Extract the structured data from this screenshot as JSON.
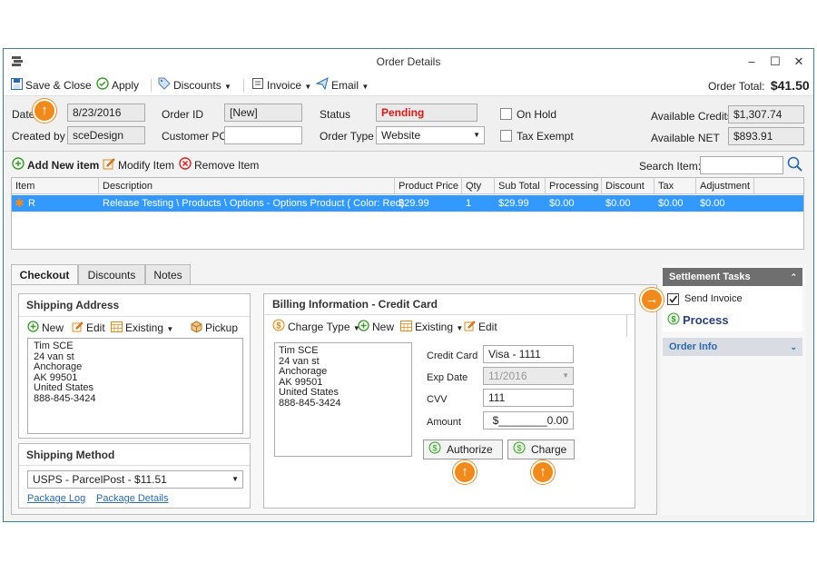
{
  "window": {
    "title": "Order Details"
  },
  "toolbar": {
    "save_close": "Save & Close",
    "apply": "Apply",
    "discounts": "Discounts",
    "invoice": "Invoice",
    "email": "Email",
    "order_total_label": "Order Total:",
    "order_total_value": "$41.50"
  },
  "header": {
    "date_label": "Date",
    "date_value": "8/23/2016",
    "created_by_label": "Created by",
    "created_by_value": "sceDesign",
    "order_id_label": "Order ID",
    "order_id_value": "[New]",
    "customer_po_label": "Customer PO",
    "customer_po_value": "",
    "status_label": "Status",
    "status_value": "Pending",
    "order_type_label": "Order Type",
    "order_type_value": "Website",
    "on_hold_label": "On Hold",
    "tax_exempt_label": "Tax Exempt",
    "available_credits_label": "Available Credits",
    "available_credits_value": "$1,307.74",
    "available_net_label": "Available NET",
    "available_net_value": "$893.91"
  },
  "items_bar": {
    "add": "Add New item",
    "modify": "Modify Item",
    "remove": "Remove Item",
    "search_label": "Search Item:",
    "search_value": ""
  },
  "grid": {
    "columns": [
      "Item",
      "Description",
      "Product Price",
      "Qty",
      "Sub Total",
      "Processing",
      "Discount",
      "Tax",
      "Adjustment"
    ],
    "rows": [
      [
        "R",
        "Release Testing \\ Products \\ Options - Options Product ( Color: Red)",
        "$29.99",
        "1",
        "$29.99",
        "$0.00",
        "$0.00",
        "$0.00",
        "$0.00"
      ]
    ]
  },
  "tabs": {
    "checkout": "Checkout",
    "discounts": "Discounts",
    "notes": "Notes"
  },
  "shipping_address": {
    "title": "Shipping Address",
    "new": "New",
    "edit": "Edit",
    "existing": "Existing",
    "pickup": "Pickup",
    "lines": [
      "Tim SCE",
      "24 van st",
      "Anchorage",
      "AK 99501",
      "United States",
      "888-845-3424"
    ]
  },
  "shipping_method": {
    "title": "Shipping Method",
    "value": "USPS - ParcelPost - $11.51",
    "package_log": "Package Log",
    "package_details": "Package Details"
  },
  "billing": {
    "title": "Billing Information - Credit Card",
    "charge_type": "Charge Type",
    "new": "New",
    "existing": "Existing",
    "edit": "Edit",
    "lines": [
      "Tim SCE",
      "24 van st",
      "Anchorage",
      "AK 99501",
      "United States",
      "888-845-3424"
    ],
    "credit_card_label": "Credit Card",
    "credit_card_value": "Visa - 1111",
    "exp_label": "Exp Date",
    "exp_value": "11/2016",
    "cvv_label": "CVV",
    "cvv_value": "111",
    "amount_label": "Amount",
    "amount_value": "$________0.00",
    "authorize": "Authorize",
    "charge": "Charge"
  },
  "settlement": {
    "title": "Settlement Tasks",
    "send_invoice": "Send Invoice",
    "process": "Process",
    "order_info": "Order Info"
  },
  "colors": {
    "accent": "#3399ff",
    "orange": "#f08a1c",
    "status": "#e01818",
    "link": "#2a6ab0"
  }
}
